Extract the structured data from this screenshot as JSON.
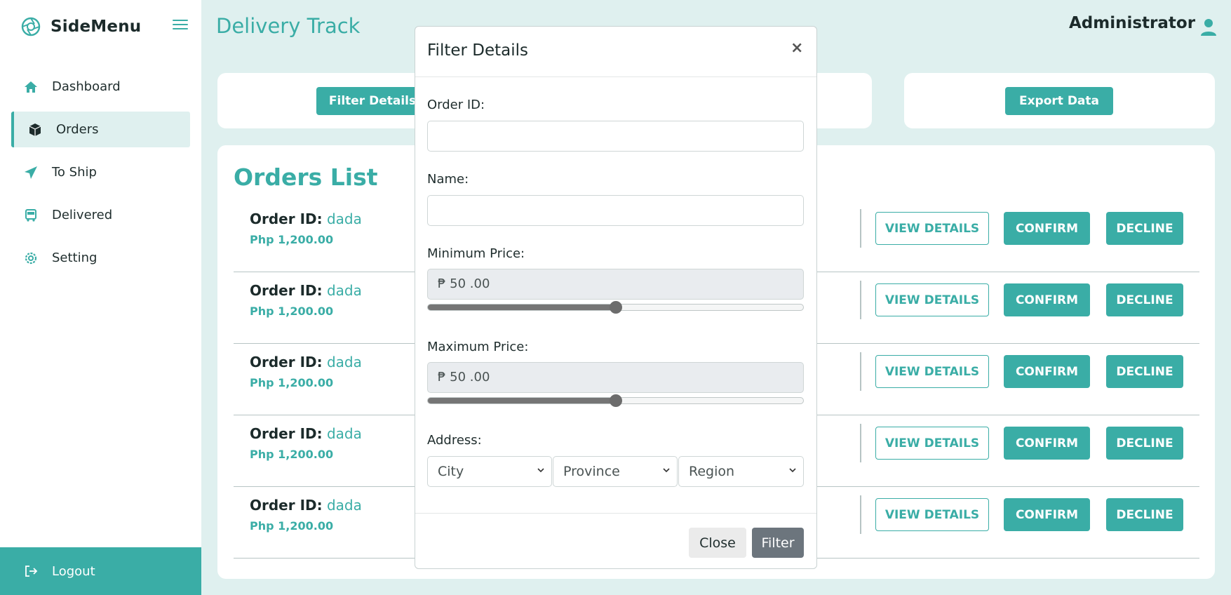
{
  "sidebar": {
    "brand": "SideMenu",
    "items": [
      {
        "label": "Dashboard",
        "icon": "home-icon"
      },
      {
        "label": "Orders",
        "icon": "box-icon",
        "active": true
      },
      {
        "label": "To Ship",
        "icon": "paper-plane-icon"
      },
      {
        "label": "Delivered",
        "icon": "truck-icon"
      },
      {
        "label": "Setting",
        "icon": "gear-icon"
      }
    ],
    "logout": "Logout"
  },
  "header": {
    "title": "Delivery Track",
    "user": "Administrator"
  },
  "toolbar": {
    "filter_label": "Filter Details",
    "export_label": "Export Data"
  },
  "orders": {
    "title": "Orders List",
    "id_label": "Order ID:",
    "view_label": "VIEW DETAILS",
    "confirm_label": "CONFIRM",
    "decline_label": "DECLINE",
    "rows": [
      {
        "id": "dada",
        "price": "Php 1,200.00"
      },
      {
        "id": "dada",
        "price": "Php 1,200.00"
      },
      {
        "id": "dada",
        "price": "Php 1,200.00"
      },
      {
        "id": "dada",
        "price": "Php 1,200.00"
      },
      {
        "id": "dada",
        "price": "Php 1,200.00"
      }
    ]
  },
  "modal": {
    "title": "Filter Details",
    "close_x": "×",
    "order_id_label": "Order ID:",
    "order_id_value": "",
    "name_label": "Name:",
    "name_value": "",
    "min_price_label": "Minimum Price:",
    "min_price_value": "₱ 50 .00",
    "min_price_level": 0.5,
    "max_price_label": "Maximum Price:",
    "max_price_value": "₱ 50 .00",
    "max_price_level": 0.5,
    "address_label": "Address:",
    "city": "City",
    "province": "Province",
    "region": "Region",
    "close_label": "Close",
    "filter_label": "Filter"
  },
  "colors": {
    "accent": "#3aada6",
    "background": "#dff0ef",
    "secondary_button": "#6c757d"
  }
}
